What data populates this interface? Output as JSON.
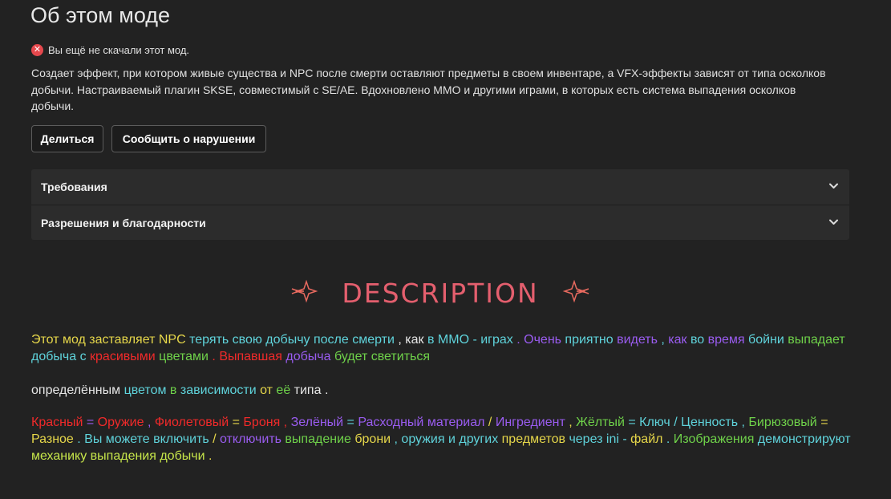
{
  "header": {
    "title": "Об этом моде"
  },
  "status": {
    "icon": "close-circle-icon",
    "text": "Вы ещё не скачали этот мод."
  },
  "summary": "Создает эффект, при котором живые существа и NPC после смерти оставляют предметы в своем инвентаре, а VFX-эффекты зависят от типа осколков добычи. Настраиваемый плагин SKSE, совместимый с SE/AE. Вдохновлено MMO и другими играми, в которых есть система выпадения осколков добычи.",
  "buttons": {
    "share": "Делиться",
    "report": "Сообщить о нарушении"
  },
  "accordion": [
    {
      "label": "Требования",
      "icon": "chevron-down-icon"
    },
    {
      "label": "Разрешения и благодарности",
      "icon": "chevron-down-icon"
    }
  ],
  "banner": {
    "title": "DESCRIPTION",
    "color": "#e45f6e"
  },
  "colors": {
    "yellow": "#e6d74a",
    "cyan": "#5fd3db",
    "purple": "#9a5cf0",
    "red": "#f02a2a",
    "green": "#6fd24a",
    "lime": "#c7e64a"
  },
  "description": {
    "para1": [
      {
        "t": "Этот мод заставляет",
        "c": "y"
      },
      {
        "t": " NPC",
        "c": "y"
      },
      {
        "t": " терять свою добычу после смерти",
        "c": "c"
      },
      {
        "t": " , как",
        "c": "w"
      },
      {
        "t": " в MMO - играх",
        "c": "c"
      },
      {
        "t": " . Очень",
        "c": "p"
      },
      {
        "t": " приятно",
        "c": "c"
      },
      {
        "t": " видеть",
        "c": "p"
      },
      {
        "t": " ,",
        "c": "c"
      },
      {
        "t": " как",
        "c": "p"
      },
      {
        "t": " во",
        "c": "c"
      },
      {
        "t": " время",
        "c": "p"
      },
      {
        "t": " бойни",
        "c": "c"
      },
      {
        "t": " выпадает",
        "c": "g"
      },
      {
        "t": " добыча с",
        "c": "c"
      },
      {
        "t": " красивыми",
        "c": "r"
      },
      {
        "t": " цветами",
        "c": "g"
      },
      {
        "t": " . Выпавшая",
        "c": "r"
      },
      {
        "t": " добыча",
        "c": "p"
      },
      {
        "t": " будет светиться",
        "c": "g"
      }
    ],
    "para2": [
      {
        "t": "определённым",
        "c": "w"
      },
      {
        "t": " цветом",
        "c": "c"
      },
      {
        "t": " в",
        "c": "g"
      },
      {
        "t": " зависимости",
        "c": "c"
      },
      {
        "t": " от",
        "c": "y"
      },
      {
        "t": " её",
        "c": "g"
      },
      {
        "t": " типа",
        "c": "w"
      },
      {
        "t": " .",
        "c": "w"
      }
    ],
    "para3": [
      {
        "t": "Красный",
        "c": "r"
      },
      {
        "t": " =",
        "c": "p"
      },
      {
        "t": " Оружие",
        "c": "r"
      },
      {
        "t": " ,",
        "c": "p"
      },
      {
        "t": " Фиолетовый",
        "c": "r"
      },
      {
        "t": " =",
        "c": "y"
      },
      {
        "t": " Броня",
        "c": "r"
      },
      {
        "t": " ,",
        "c": "r"
      },
      {
        "t": " Зелёный",
        "c": "p"
      },
      {
        "t": " =",
        "c": "c"
      },
      {
        "t": " Расходный материал",
        "c": "p"
      },
      {
        "t": " /",
        "c": "y"
      },
      {
        "t": " Ингредиент",
        "c": "p"
      },
      {
        "t": " ,",
        "c": "y"
      },
      {
        "t": " Жёлтый",
        "c": "g"
      },
      {
        "t": " = Ключ / Ценность ,",
        "c": "c"
      },
      {
        "t": " Бирюзовый",
        "c": "g"
      },
      {
        "t": " = Разное",
        "c": "y"
      },
      {
        "t": " . Вы",
        "c": "c"
      },
      {
        "t": " можете включить",
        "c": "c"
      },
      {
        "t": " /",
        "c": "y"
      },
      {
        "t": " отключить",
        "c": "p"
      },
      {
        "t": " выпадение",
        "c": "g"
      },
      {
        "t": " брони",
        "c": "y"
      },
      {
        "t": " , оружия и других",
        "c": "c"
      },
      {
        "t": " предметов",
        "c": "y"
      },
      {
        "t": " через ini -",
        "c": "c"
      },
      {
        "t": " файл",
        "c": "y"
      },
      {
        "t": " .",
        "c": "c"
      },
      {
        "t": " Изображения",
        "c": "g"
      },
      {
        "t": " демонстрируют",
        "c": "c"
      },
      {
        "t": " механику выпадения добычи",
        "c": "l"
      },
      {
        "t": " .",
        "c": "y"
      }
    ]
  }
}
